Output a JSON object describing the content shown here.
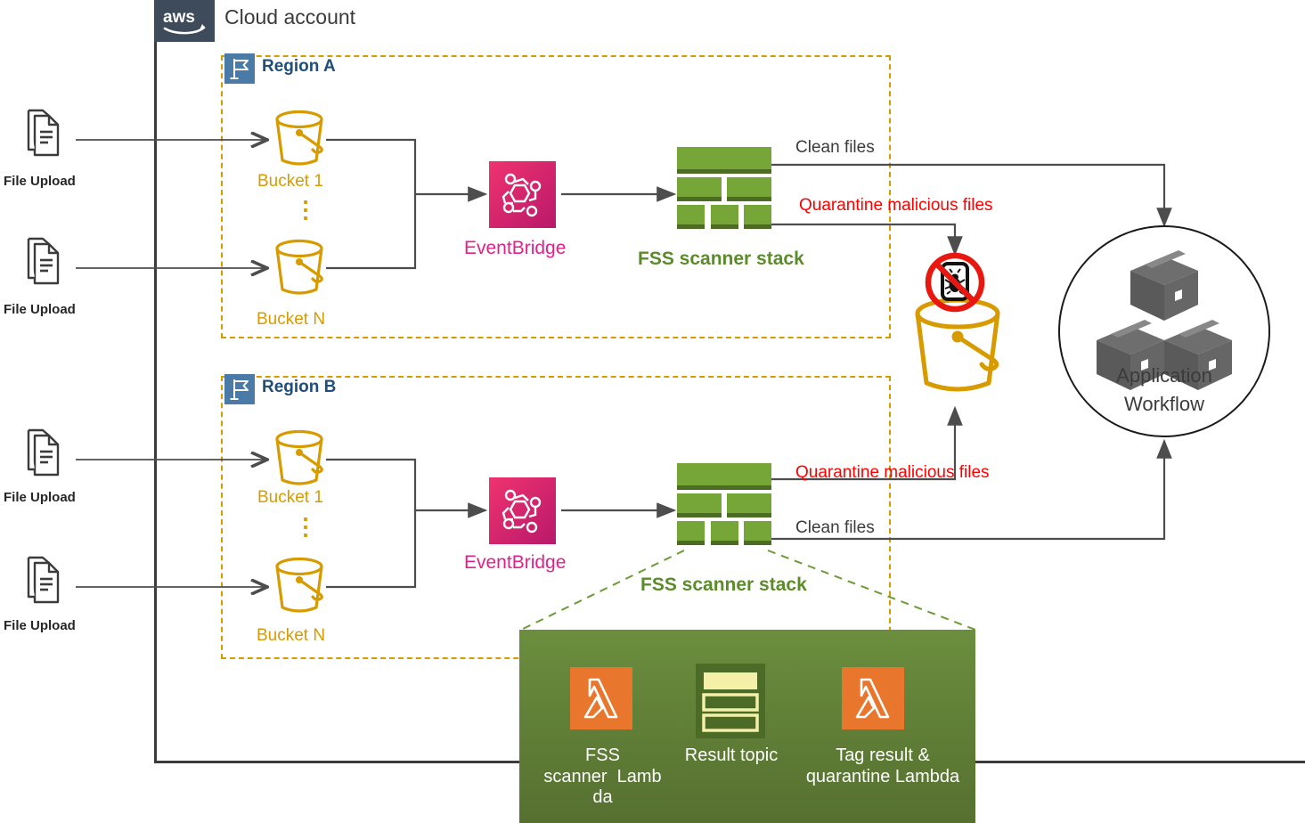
{
  "diagram": {
    "title": "Cloud account",
    "aws_logo_text": "aws",
    "regions": [
      {
        "label": "Region A",
        "icon": "flag-icon"
      },
      {
        "label": "Region B",
        "icon": "flag-icon"
      }
    ],
    "file_uploads": [
      {
        "label": "File Upload",
        "icon": "document-upload-icon"
      },
      {
        "label": "File Upload",
        "icon": "document-upload-icon"
      },
      {
        "label": "File Upload",
        "icon": "document-upload-icon"
      },
      {
        "label": "File Upload",
        "icon": "document-upload-icon"
      }
    ],
    "buckets": [
      {
        "label": "Bucket 1",
        "icon": "s3-bucket-icon"
      },
      {
        "label": "Bucket N",
        "icon": "s3-bucket-icon"
      },
      {
        "label": "Bucket 1",
        "icon": "s3-bucket-icon"
      },
      {
        "label": "Bucket N",
        "icon": "s3-bucket-icon"
      }
    ],
    "ellipsis": "⋮",
    "eventbridge": [
      {
        "label": "EventBridge",
        "icon": "eventbridge-icon"
      },
      {
        "label": "EventBridge",
        "icon": "eventbridge-icon"
      }
    ],
    "scanner_stacks": [
      {
        "label": "FSS scanner stack",
        "icon": "stack-icon"
      },
      {
        "label": "FSS scanner stack",
        "icon": "stack-icon"
      }
    ],
    "flow_labels": {
      "clean_a": "Clean files",
      "quarantine_a": "Quarantine malicious files",
      "quarantine_b": "Quarantine malicious files",
      "clean_b": "Clean files"
    },
    "quarantine_bucket": {
      "icon": "quarantine-bucket-icon",
      "badge_icon": "no-malware-icon"
    },
    "application_workflow": {
      "line1": "Application",
      "line2": "Workflow",
      "icon": "three-boxes-icon"
    },
    "detail_panel": {
      "nodes": [
        {
          "label": "FSS\nscanner  Lamb\nda",
          "icon": "lambda-icon"
        },
        {
          "label": "Result topic",
          "icon": "sns-topic-icon"
        },
        {
          "label": "Tag result &\nquarantine Lambda",
          "icon": "lambda-icon"
        }
      ]
    },
    "colors": {
      "aws_navy": "#3e4b5b",
      "region_gold": "#d79b00",
      "region_blue": "#1f4e79",
      "flag_blue": "#4a7ba7",
      "eventbridge_pink": "#e0218a",
      "stack_green": "#76a538",
      "panel_green": "#6b8e3e",
      "lambda_orange": "#e8762c",
      "alert_red": "#ff0000",
      "line_gray": "#4d4d4d",
      "label_green": "#5b8c2a"
    }
  }
}
